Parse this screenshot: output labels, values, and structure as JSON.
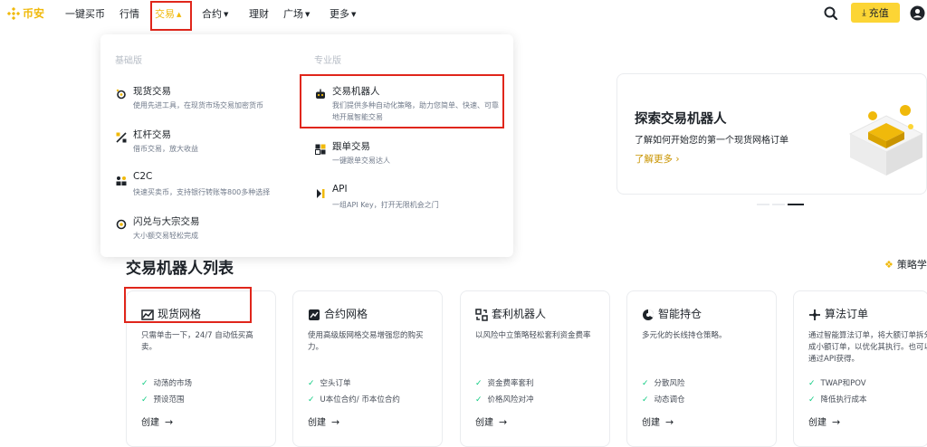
{
  "nav": {
    "logo_text": "币安",
    "items": [
      {
        "label": "一键买币",
        "dropdown": false
      },
      {
        "label": "行情",
        "dropdown": false
      },
      {
        "label": "交易",
        "dropdown": true,
        "active": true
      },
      {
        "label": "合约",
        "dropdown": true
      },
      {
        "label": "理财",
        "dropdown": false
      },
      {
        "label": "广场",
        "dropdown": true
      },
      {
        "label": "更多",
        "dropdown": true
      }
    ],
    "search_icon": "search-icon",
    "deposit_label": "充值",
    "user_icon": "user-circle-icon"
  },
  "dropdown": {
    "basic_title": "基础版",
    "pro_title": "专业版",
    "basic_items": [
      {
        "title": "现货交易",
        "desc": "使用先进工具，在现货市场交易加密货币",
        "icon": "spot-icon"
      },
      {
        "title": "杠杆交易",
        "desc": "借币交易，放大收益",
        "icon": "margin-icon"
      },
      {
        "title": "C2C",
        "desc": "快速买卖币，支持银行转账等800多种选择",
        "icon": "c2c-icon"
      },
      {
        "title": "闪兑与大宗交易",
        "desc": "大小额交易轻松完成",
        "icon": "convert-icon"
      }
    ],
    "pro_items": [
      {
        "title": "交易机器人",
        "desc": "我们提供多种自动化策略，助力您简单、快速、可靠地开展智能交易",
        "icon": "robot-icon"
      },
      {
        "title": "跟单交易",
        "desc": "一键跟单交易达人",
        "icon": "copy-trading-icon"
      },
      {
        "title": "API",
        "desc": "一组API Key，打开无限机会之门",
        "icon": "api-icon"
      }
    ]
  },
  "promo": {
    "title": "探索交易机器人",
    "desc": "了解如何开始您的第一个现货网格订单",
    "link": "了解更多",
    "link_arrow": "›"
  },
  "section": {
    "title": "交易机器人列表",
    "strategy_link": "策略学"
  },
  "cards": [
    {
      "title": "现货网格",
      "icon": "spot-grid-icon",
      "desc": "只需单击一下，24/7 自动低买高卖。",
      "features": [
        "动荡的市场",
        "预设范围"
      ],
      "create": "创建"
    },
    {
      "title": "合约网格",
      "icon": "futures-grid-icon",
      "desc": "使用高级版网格交易增强您的购买力。",
      "features": [
        "空头订单",
        "U本位合约/ 币本位合约"
      ],
      "create": "创建"
    },
    {
      "title": "套利机器人",
      "icon": "arbitrage-icon",
      "desc": "以风险中立策略轻松套利资金费率",
      "features": [
        "资金费率套利",
        "价格风险对冲"
      ],
      "create": "创建"
    },
    {
      "title": "智能持仓",
      "icon": "rebalance-icon",
      "desc": "多元化的长线持仓策略。",
      "features": [
        "分散风险",
        "动态调仓"
      ],
      "create": "创建"
    },
    {
      "title": "算法订单",
      "icon": "algo-order-icon",
      "desc": "通过智能算法订单，将大额订单拆分成小额订单，以优化其执行。也可以通过API获得。",
      "features": [
        "TWAP和POV",
        "降低执行成本"
      ],
      "create": "创建"
    }
  ],
  "colors": {
    "brand": "#F0B90B",
    "button": "#FCD535",
    "highlight": "#e0261b",
    "check": "#0ecb81"
  }
}
